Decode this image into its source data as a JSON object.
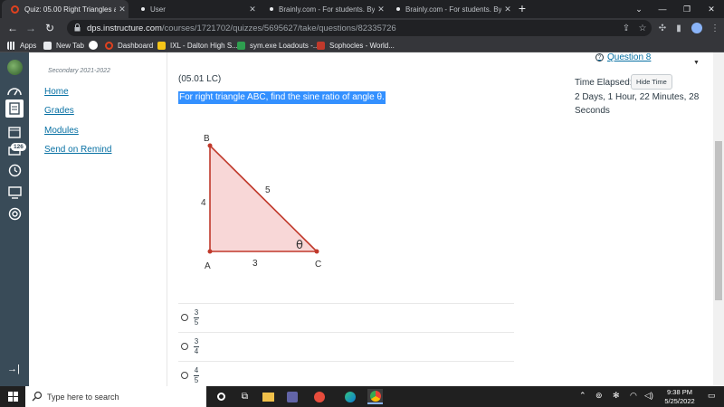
{
  "browser": {
    "tabs": [
      {
        "title": "Quiz: 05.00 Right Triangles and T",
        "active": true
      },
      {
        "title": "User",
        "active": false
      },
      {
        "title": "Brainly.com - For students. By stu",
        "active": false
      },
      {
        "title": "Brainly.com - For students. By stu",
        "active": false
      }
    ],
    "url_host": "dps.instructure.com",
    "url_path": "/courses/1721702/quizzes/5695627/take/questions/82335726",
    "bookmarks": [
      "Apps",
      "New Tab",
      "Dashboard",
      "IXL - Dalton High S...",
      "sym.exe Loadouts -...",
      "Sophocles - World..."
    ]
  },
  "global_nav": {
    "inbox_badge": "126"
  },
  "course_nav": {
    "term": "Secondary 2021-2022",
    "links": [
      "Home",
      "Grades",
      "Modules",
      "Send on Remind"
    ]
  },
  "question": {
    "number": "(05.01 LC)",
    "text": "For right triangle ABC, find the sine ratio of angle θ.",
    "figure": {
      "vertices": {
        "A": "A",
        "B": "B",
        "C": "C"
      },
      "sides": {
        "AB": "4",
        "BC": "5",
        "AC": "3"
      },
      "angle_label": "θ",
      "fill_color": "#f8d7d7",
      "stroke_color": "#c0392b"
    },
    "options": [
      {
        "num": "3",
        "den": "5"
      },
      {
        "num": "3",
        "den": "4"
      },
      {
        "num": "4",
        "den": "5"
      }
    ]
  },
  "sidebar": {
    "question_link": "Question 8",
    "time_label": "Time Elapsed:",
    "hide_time_button": "Hide Time",
    "elapsed": "2 Days, 1 Hour, 22 Minutes, 28 Seconds"
  },
  "taskbar": {
    "search_placeholder": "Type here to search",
    "time": "9:38 PM",
    "date": "5/25/2022"
  }
}
